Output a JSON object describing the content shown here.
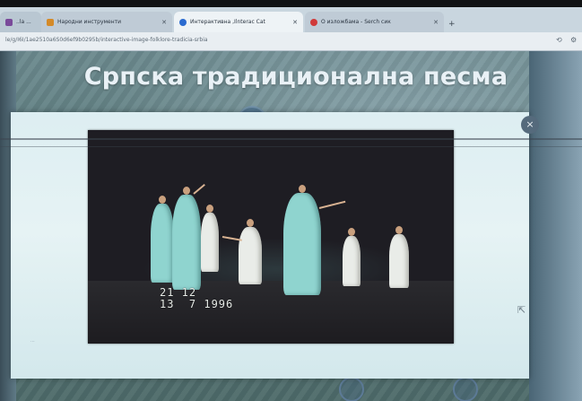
{
  "browser": {
    "tabs": [
      {
        "label": "..la ...",
        "favicon_color": "#7a4a9a"
      },
      {
        "label": "Народни инструменти",
        "favicon_color": "#d48a28"
      },
      {
        "label": "Интерактивна ,Ilnterac Cat",
        "favicon_color": "#2a6bd0"
      },
      {
        "label": "О изложбама - Serch сик",
        "favicon_color": "#d03a3a"
      }
    ],
    "new_tab_icon": "+",
    "url": "le/g/I6I/1ae2510a6S0d6ef9b0295b/interactive-image-folklore-tradicia-srbia",
    "toolbar_icons": [
      "reload-icon",
      "settings-icon"
    ]
  },
  "page": {
    "title": "Српска традиционална песма"
  },
  "dialog": {
    "close_icon": "×",
    "footer_text": "...",
    "cursor_icon": "⇱"
  },
  "video": {
    "timestamp_line1": "21 12",
    "timestamp_line2": "13  7 1996",
    "accent_costume": "#8fd4cf",
    "accent_white": "#e9ece8"
  }
}
